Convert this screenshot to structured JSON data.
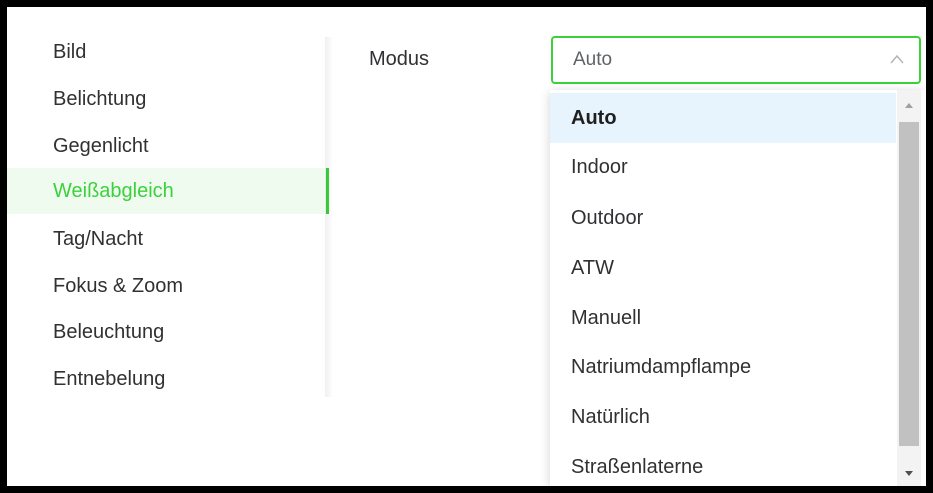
{
  "sidebar": {
    "items": [
      {
        "label": "Bild"
      },
      {
        "label": "Belichtung"
      },
      {
        "label": "Gegenlicht"
      },
      {
        "label": "Weißabgleich"
      },
      {
        "label": "Tag/Nacht"
      },
      {
        "label": "Fokus & Zoom"
      },
      {
        "label": "Beleuchtung"
      },
      {
        "label": "Entnebelung"
      }
    ],
    "active_index": 3
  },
  "form": {
    "mode_label": "Modus",
    "mode_value": "Auto"
  },
  "dropdown": {
    "options": [
      {
        "label": "Auto"
      },
      {
        "label": "Indoor"
      },
      {
        "label": "Outdoor"
      },
      {
        "label": "ATW"
      },
      {
        "label": "Manuell"
      },
      {
        "label": "Natriumdampflampe"
      },
      {
        "label": "Natürlich"
      },
      {
        "label": "Straßenlaterne"
      }
    ],
    "selected_index": 0
  },
  "colors": {
    "accent": "#3cd13c",
    "selected_bg": "#e8f4fd",
    "text": "#303133"
  },
  "icons": {
    "select_arrow": "chevron-up-icon",
    "scroll_up": "triangle-up-icon",
    "scroll_down": "triangle-down-icon"
  }
}
